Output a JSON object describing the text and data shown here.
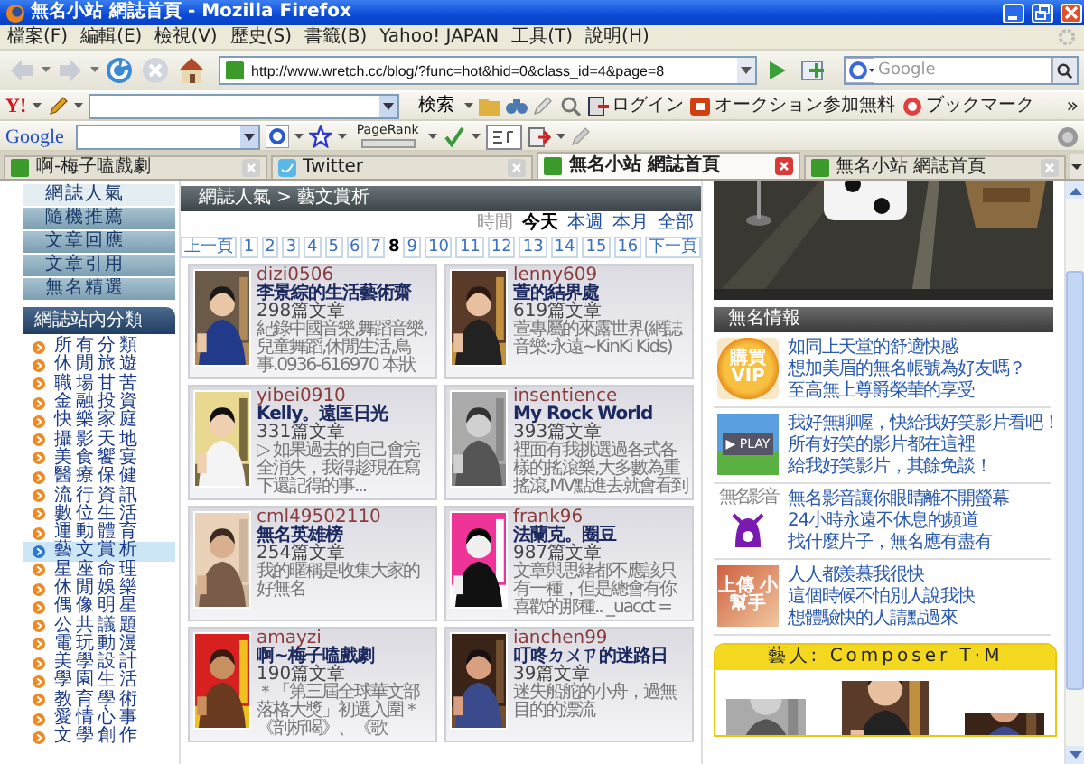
{
  "window": {
    "title": "無名小站 網誌首頁 - Mozilla Firefox"
  },
  "menu": [
    "檔案(F)",
    "編輯(E)",
    "檢視(V)",
    "歷史(S)",
    "書籤(B)",
    "Yahoo! JAPAN",
    "工具(T)",
    "說明(H)"
  ],
  "address_bar": {
    "url": "http://www.wretch.cc/blog/?func=hot&hid=0&class_id=4&page=8"
  },
  "search_box": {
    "placeholder": "Google"
  },
  "yahoo_toolbar": {
    "logo": "Y!",
    "search_button": "検索",
    "links": [
      "ログイン",
      "オークション参加無料",
      "ブックマーク"
    ],
    "overflow": "»"
  },
  "google_toolbar": {
    "logo": "Google",
    "pagerank": "PageRank"
  },
  "tabs": [
    {
      "label": "啊-梅子嗑戲劇",
      "selected": false
    },
    {
      "label": "Twitter",
      "selected": false
    },
    {
      "label": "無名小站 網誌首頁",
      "selected": true
    },
    {
      "label": "無名小站 網誌首頁",
      "selected": false
    }
  ],
  "sidebar": {
    "nav_items": [
      {
        "label": "網誌人氣",
        "selected": true
      },
      {
        "label": "隨機推薦",
        "selected": false
      },
      {
        "label": "文章回應",
        "selected": false
      },
      {
        "label": "文章引用",
        "selected": false
      },
      {
        "label": "無名精選",
        "selected": false
      }
    ],
    "category_heading": "網誌站內分類",
    "categories": [
      {
        "label": "所有分類",
        "selected": false
      },
      {
        "label": "休閒旅遊",
        "selected": false
      },
      {
        "label": "職場甘苦",
        "selected": false
      },
      {
        "label": "金融投資",
        "selected": false
      },
      {
        "label": "快樂家庭",
        "selected": false
      },
      {
        "label": "攝影天地",
        "selected": false
      },
      {
        "label": "美食饗宴",
        "selected": false
      },
      {
        "label": "醫療保健",
        "selected": false
      },
      {
        "label": "流行資訊",
        "selected": false
      },
      {
        "label": "數位生活",
        "selected": false
      },
      {
        "label": "運動體育",
        "selected": false
      },
      {
        "label": "藝文賞析",
        "selected": true
      },
      {
        "label": "星座命理",
        "selected": false
      },
      {
        "label": "休閒娛樂",
        "selected": false
      },
      {
        "label": "偶像明星",
        "selected": false
      },
      {
        "label": "公共議題",
        "selected": false
      },
      {
        "label": "電玩動漫",
        "selected": false
      },
      {
        "label": "美學設計",
        "selected": false
      },
      {
        "label": "學園生活",
        "selected": false
      },
      {
        "label": "教育學術",
        "selected": false
      },
      {
        "label": "愛情心事",
        "selected": false
      },
      {
        "label": "文學創作",
        "selected": false
      }
    ]
  },
  "main": {
    "breadcrumb": "網誌人氣 > 藝文賞析",
    "time_label": "時間",
    "time_filters": [
      {
        "label": "今天",
        "selected": true
      },
      {
        "label": "本週",
        "selected": false
      },
      {
        "label": "本月",
        "selected": false
      },
      {
        "label": "全部",
        "selected": false
      }
    ],
    "pagination": {
      "previous": "上一頁",
      "next": "下一頁",
      "pages": [
        {
          "label": "1",
          "selected": false
        },
        {
          "label": "2",
          "selected": false
        },
        {
          "label": "3",
          "selected": false
        },
        {
          "label": "4",
          "selected": false
        },
        {
          "label": "5",
          "selected": false
        },
        {
          "label": "6",
          "selected": false
        },
        {
          "label": "7",
          "selected": false
        },
        {
          "label": "8",
          "selected": true
        },
        {
          "label": "9",
          "selected": false
        },
        {
          "label": "10",
          "selected": false
        },
        {
          "label": "11",
          "selected": false
        },
        {
          "label": "12",
          "selected": false
        },
        {
          "label": "13",
          "selected": false
        },
        {
          "label": "14",
          "selected": false
        },
        {
          "label": "15",
          "selected": false
        },
        {
          "label": "16",
          "selected": false
        }
      ]
    },
    "blogs": [
      {
        "user": "dizi0506",
        "title": "李景綜的生活藝術齋",
        "count": "298篇文章",
        "description": "紀錄中國音樂,舞蹈音樂,兒童舞蹈,休閒生活,鳥事.0936-616970 本狀"
      },
      {
        "user": "lenny609",
        "title": "萱的結界處",
        "count": "619篇文章",
        "description": "萱專屬的來露世界(網誌音樂:永遠~KinKi Kids)"
      },
      {
        "user": "yibei0910",
        "title": "Kelly。遠匡日光",
        "count": "331篇文章",
        "description": "▷ 如果過去的自己會完全消失，我得趁現在寫下還記得的事..."
      },
      {
        "user": "insentience",
        "title": "My Rock World",
        "count": "393篇文章",
        "description": "裡面有我挑選過各式各樣的搖滾樂,大多數為重搖滾,MV點進去就會看到"
      },
      {
        "user": "cml49502110",
        "title": "無名英雄榜",
        "count": "254篇文章",
        "description": "我的暱稱是收集大家的好無名"
      },
      {
        "user": "frank96",
        "title": "法蘭克。圈豆",
        "count": "987篇文章",
        "description": "文章與思緒都不應該只有一種，但是總會有你喜歡的那種.. _uacct ="
      },
      {
        "user": "amayzi",
        "title": "啊~梅子嗑戲劇",
        "count": "190篇文章",
        "description": "＊「第三屆全球華文部落格大獎」初選入圍＊《剖析喝》、《歌"
      },
      {
        "user": "ianchen99",
        "title": "叮咚ㄉㄨㄗ的迷路日",
        "count": "39篇文章",
        "description": "迷失船舵的小舟，過無目的的漂流"
      }
    ]
  },
  "right": {
    "news_heading": "無名情報",
    "promos": [
      {
        "kind": "vip",
        "badge": "購買 VIP",
        "links": [
          "如同上天堂的舒適快感",
          "想加美眉的無名帳號為好友嗎？",
          "至高無上尊爵榮華的享受"
        ]
      },
      {
        "kind": "play",
        "badge": "▶ PLAY",
        "links": [
          "我好無聊喔，快給我好笑影片看吧！",
          "所有好笑的影片都在這裡",
          "給我好笑影片，其餘免談！"
        ]
      },
      {
        "kind": "video",
        "badge": "無名影音",
        "links": [
          "無名影音讓你眼睛離不開螢幕",
          "24小時永遠不休息的頻道",
          "找什麼片子，無名應有盡有"
        ]
      },
      {
        "kind": "upload",
        "badge": "上傳 小幫手",
        "links": [
          "人人都羨慕我很快",
          "這個時候不怕別人說我快",
          "想體驗快的人請點過來"
        ]
      }
    ],
    "artist_heading": "藝人: Composer T·M"
  }
}
